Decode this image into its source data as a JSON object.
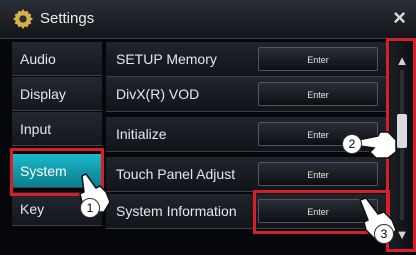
{
  "header": {
    "title": "Settings",
    "gear_icon": "gear-icon",
    "close_label": "×"
  },
  "sidebar": {
    "items": [
      {
        "label": "Audio"
      },
      {
        "label": "Display"
      },
      {
        "label": "Input"
      },
      {
        "label": "System"
      },
      {
        "label": "Key"
      }
    ],
    "active": "System"
  },
  "rows": [
    {
      "label": "SETUP Memory",
      "button": "Enter"
    },
    {
      "label": "DivX(R) VOD",
      "button": "Enter"
    },
    {
      "label": "Initialize",
      "button": "Enter"
    },
    {
      "label": "Touch Panel Adjust",
      "button": "Enter"
    },
    {
      "label": "System Information",
      "button": "Enter"
    }
  ],
  "scrollbar": {
    "up_label": "▲",
    "down_label": "▼",
    "scroll_position": 0.4
  },
  "annotations": [
    {
      "number": "1"
    },
    {
      "number": "2"
    },
    {
      "number": "3"
    }
  ],
  "colors": {
    "accent": "#0a7e90",
    "highlight": "#d81e2a"
  }
}
